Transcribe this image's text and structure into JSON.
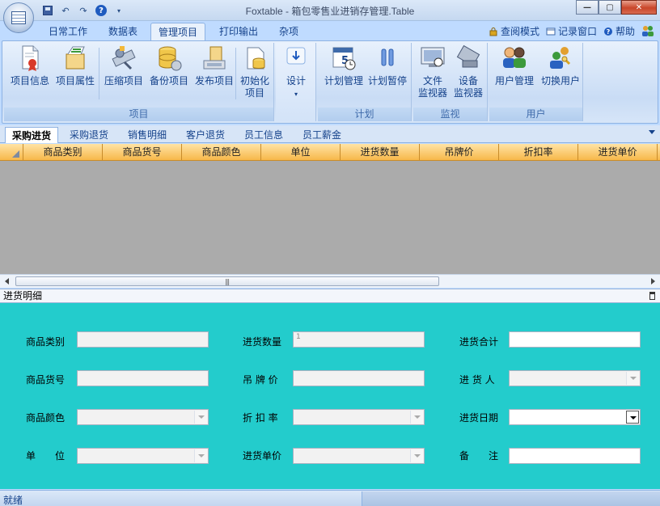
{
  "window": {
    "title": "Foxtable - 箱包零售业进销存管理.Table",
    "colors": {
      "accent": "#15428b",
      "grid_header": "#f7b84a",
      "panel_bg": "#23cccc",
      "grid_body": "#ababab"
    }
  },
  "ribbon_tabs": [
    "日常工作",
    "数据表",
    "管理项目",
    "打印输出",
    "杂项"
  ],
  "ribbon_active_tab": "管理项目",
  "ribbon_right": {
    "read_mode": "查阅模式",
    "record_window": "记录窗口",
    "help": "帮助"
  },
  "ribbon_groups": {
    "project": {
      "label": "项目",
      "buttons": [
        "项目信息",
        "项目属性",
        "压缩项目",
        "备份项目",
        "发布项目",
        "初始化",
        "项目"
      ]
    },
    "design": {
      "label": "设计",
      "more": "▾"
    },
    "plan": {
      "label": "计划",
      "buttons": [
        "计划管理",
        "计划暂停"
      ]
    },
    "monitor": {
      "label": "监视",
      "buttons": [
        "文件",
        "监视器",
        "设备",
        "监视器"
      ]
    },
    "user": {
      "label": "用户",
      "buttons": [
        "用户管理",
        "切换用户"
      ]
    }
  },
  "doc_tabs": [
    "采购进货",
    "采购退货",
    "销售明细",
    "客户退货",
    "员工信息",
    "员工薪金"
  ],
  "doc_active_tab": "采购进货",
  "grid_columns": [
    "商品类别",
    "商品货号",
    "商品颜色",
    "单位",
    "进货数量",
    "吊牌价",
    "折扣率",
    "进货单价"
  ],
  "detail_panel": {
    "title": "进货明细",
    "fields": {
      "category": {
        "label": "商品类别",
        "value": ""
      },
      "item_no": {
        "label": "商品货号",
        "value": ""
      },
      "color": {
        "label": "商品颜色",
        "value": ""
      },
      "unit": {
        "label": "单　　位",
        "value": ""
      },
      "qty": {
        "label": "进货数量",
        "value": "1"
      },
      "tag_price": {
        "label": "吊 牌 价",
        "value": ""
      },
      "discount": {
        "label": "折 扣 率",
        "value": ""
      },
      "unit_price": {
        "label": "进货单价",
        "value": ""
      },
      "total": {
        "label": "进货合计",
        "value": ""
      },
      "buyer": {
        "label": "进 货 人",
        "value": ""
      },
      "date": {
        "label": "进货日期",
        "value": ""
      },
      "note": {
        "label": "备　　注",
        "value": ""
      }
    }
  },
  "status": {
    "text": "就绪"
  }
}
